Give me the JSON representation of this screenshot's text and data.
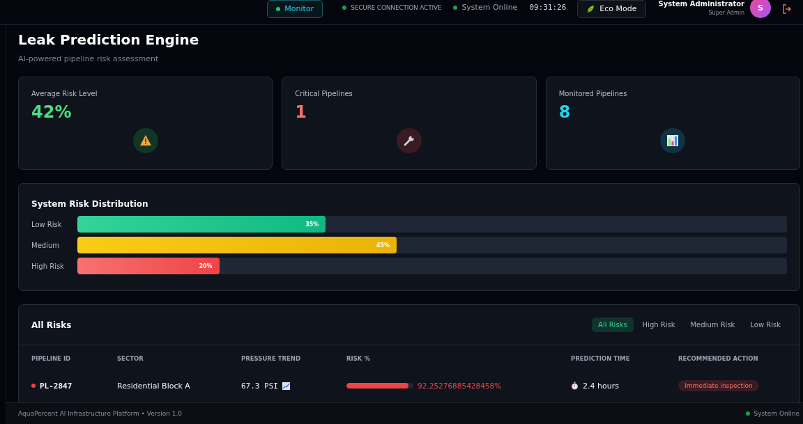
{
  "top_bar": {
    "mode_button": {
      "label": "Monitor",
      "selected": true
    },
    "connection_status": "SECURE CONNECTION ACTIVE",
    "system_status": "System Online",
    "clock": "09:31:26",
    "eco_button": {
      "label": "Eco Mode",
      "on": false
    },
    "user": {
      "name": "System Administrator",
      "role": "Super Admin",
      "initial": "S"
    }
  },
  "page": {
    "title": "Leak Prediction Engine",
    "subtitle": "AI-powered pipeline risk assessment"
  },
  "stat_cards": [
    {
      "label": "Average Risk Level",
      "value": "42%",
      "kind": "warning",
      "color": "#4ade80"
    },
    {
      "label": "Critical Pipelines",
      "value": "1",
      "kind": "wrench",
      "color": "#f87171"
    },
    {
      "label": "Monitored Pipelines",
      "value": "8",
      "kind": "chart",
      "color": "#22d3ee"
    }
  ],
  "distribution": {
    "title": "System Risk Distribution",
    "rows": [
      {
        "label": "Low Risk",
        "level": 0.35,
        "reading": "35%",
        "kind": "low"
      },
      {
        "label": "Medium",
        "level": 0.45,
        "reading": "45%",
        "kind": "medium"
      },
      {
        "label": "High Risk",
        "level": 0.2,
        "reading": "20%",
        "kind": "high"
      }
    ]
  },
  "risks": {
    "title": "All Risks",
    "filters": [
      {
        "label": "All Risks",
        "selected": true
      },
      {
        "label": "High Risk",
        "selected": false
      },
      {
        "label": "Medium Risk",
        "selected": false
      },
      {
        "label": "Low Risk",
        "selected": false
      }
    ],
    "columns": [
      "PIPELINE ID",
      "SECTOR",
      "PRESSURE TREND",
      "RISK %",
      "PREDICTION TIME",
      "RECOMMENDED ACTION"
    ],
    "rows": [
      {
        "pipeline_id": "PL-2847",
        "color": "#ef4444",
        "sector": "Residential Block A",
        "pressure": "67.3 PSI",
        "level": 0.9225,
        "risk": "92.25276885428458%",
        "time": "2.4 hours",
        "action": "Immediate inspection"
      }
    ]
  },
  "footer": {
    "text": "AquaPercent AI Infrastructure Platform • Version 1.0",
    "status": "System Online"
  }
}
